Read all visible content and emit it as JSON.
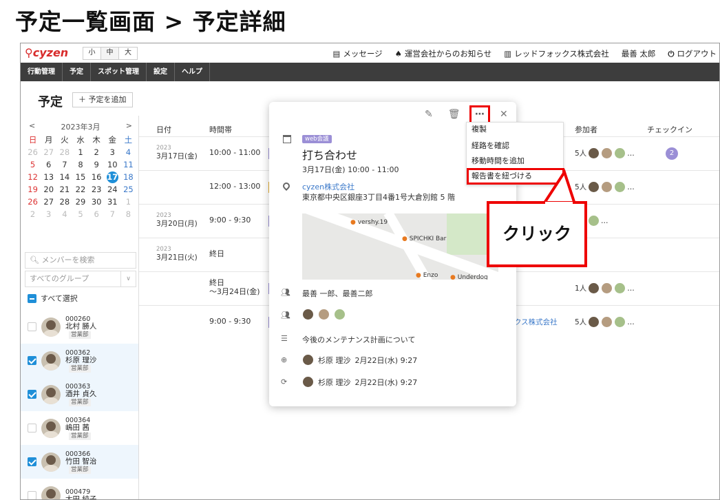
{
  "heading": "予定一覧画面 > 予定詳細",
  "topbar": {
    "logo": "cyzen",
    "font_sizes": [
      "小",
      "中",
      "大"
    ],
    "messages": "メッセージ",
    "notices": "運営会社からのお知らせ",
    "company": "レッドフォックス株式会社",
    "user": "最善 太郎",
    "logout": "ログアウト"
  },
  "nav": [
    "行動管理",
    "予定",
    "スポット管理",
    "設定",
    "ヘルプ"
  ],
  "page": {
    "title": "予定",
    "add_button": "予定を追加"
  },
  "calendar": {
    "prev": "<",
    "month": "2023年3月",
    "next": ">",
    "weekdays": [
      "日",
      "月",
      "火",
      "水",
      "木",
      "金",
      "土"
    ],
    "weeks": [
      [
        "26",
        "27",
        "28",
        "1",
        "2",
        "3",
        "4"
      ],
      [
        "5",
        "6",
        "7",
        "8",
        "9",
        "10",
        "11"
      ],
      [
        "12",
        "13",
        "14",
        "15",
        "16",
        "17",
        "18"
      ],
      [
        "19",
        "20",
        "21",
        "22",
        "23",
        "24",
        "25"
      ],
      [
        "26",
        "27",
        "28",
        "29",
        "30",
        "31",
        "1"
      ],
      [
        "2",
        "3",
        "4",
        "5",
        "6",
        "7",
        "8"
      ]
    ],
    "today": "17"
  },
  "sidebar": {
    "search_placeholder": "メンバーを検索",
    "group_select": "すべてのグループ",
    "select_all": "すべて選択",
    "members": [
      {
        "code": "000260",
        "name": "北村 勝人",
        "dept": "営業部",
        "checked": false
      },
      {
        "code": "000362",
        "name": "杉原 理沙",
        "dept": "営業部",
        "checked": true
      },
      {
        "code": "000363",
        "name": "酒井 貞久",
        "dept": "営業部",
        "checked": true
      },
      {
        "code": "000364",
        "name": "嶋田 茜",
        "dept": "営業部",
        "checked": false
      },
      {
        "code": "000366",
        "name": "竹田 智治",
        "dept": "営業部",
        "checked": true
      },
      {
        "code": "000479",
        "name": "太田 純子",
        "dept": "",
        "checked": false
      }
    ]
  },
  "table": {
    "headers": {
      "date": "日付",
      "time": "時間帯",
      "participants": "参加者",
      "checkin": "チェックイン"
    },
    "rows": [
      {
        "year": "2023",
        "date": "3月17日(金)",
        "time": "10:00 - 11:00",
        "participants": "5人",
        "checkin": "2"
      },
      {
        "year": "",
        "date": "",
        "time": "12:00 - 13:00",
        "participants": "5人",
        "checkin": ""
      },
      {
        "year": "2023",
        "date": "3月20日(月)",
        "time": "9:00 - 9:30",
        "participants": "",
        "checkin": ""
      },
      {
        "year": "2023",
        "date": "3月21日(火)",
        "time": "終日",
        "participants": "",
        "checkin": ""
      },
      {
        "year": "",
        "date": "",
        "time": "終日\n〜3月24日(金)",
        "participants": "1人",
        "checkin": ""
      },
      {
        "year": "",
        "date": "",
        "time": "9:00 - 9:30",
        "participants": "5人",
        "checkin": "",
        "company": "クス株式会社"
      }
    ]
  },
  "popup": {
    "tag": "web会議",
    "title": "打ち合わせ",
    "datetime": "3月17日(金) 10:00 - 11:00",
    "place_name": "cyzen株式会社",
    "address": "東京都中央区銀座3丁目4番1号大倉別館 5 階",
    "map_labels": [
      "vershy.19",
      "SPICHKI Bar",
      "Enzo",
      "Underdog"
    ],
    "members_text": "最善 一郎、最善二郎",
    "memo": "今後のメンテナンス計画について",
    "created": {
      "name": "杉原 理沙",
      "time": "2月22日(水) 9:27"
    },
    "updated": {
      "name": "杉原 理沙",
      "time": "2月22日(水) 9:27"
    }
  },
  "menu": {
    "items": [
      "複製",
      "経路を確認",
      "移動時間を追加",
      "報告書を紐づける"
    ]
  },
  "callout": "クリック",
  "colors": {
    "accent": "#1f8fd8",
    "highlight": "#e00000",
    "nav_bg": "#3d3d3d",
    "tag": "#9b8fd6"
  }
}
